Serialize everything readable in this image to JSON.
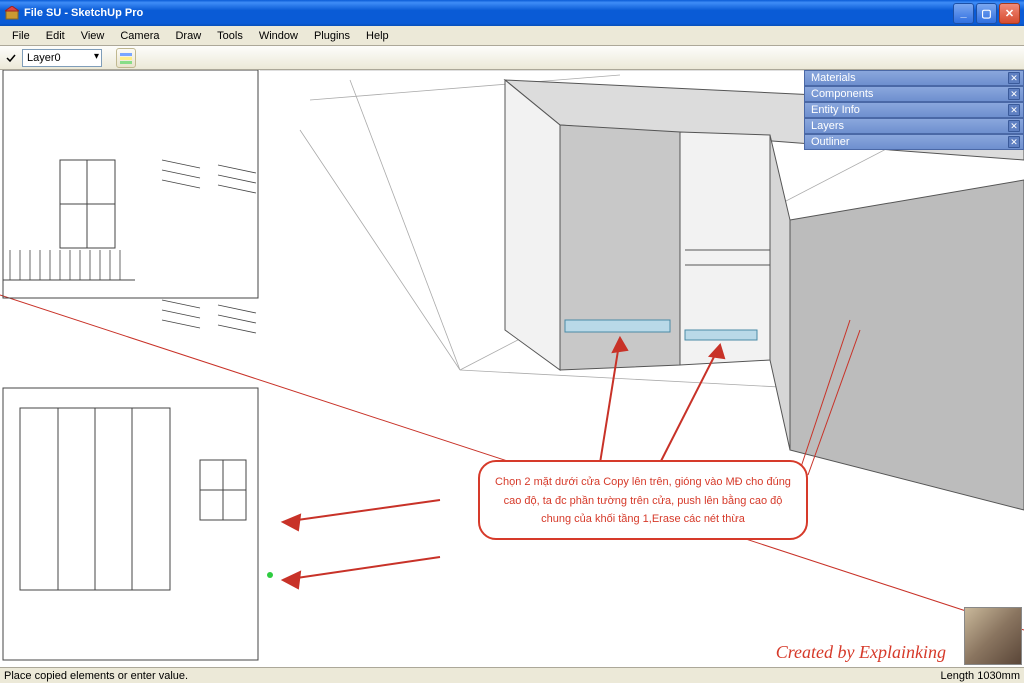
{
  "window": {
    "title": "File SU - SketchUp Pro"
  },
  "menu": {
    "items": [
      "File",
      "Edit",
      "View",
      "Camera",
      "Draw",
      "Tools",
      "Window",
      "Plugins",
      "Help"
    ]
  },
  "toolbar": {
    "layer_selected": "Layer0"
  },
  "panels": {
    "items": [
      "Materials",
      "Components",
      "Entity Info",
      "Layers",
      "Outliner"
    ]
  },
  "annotation": {
    "text": "Chọn 2 mặt dưới cửa Copy lên trên, gióng vào MĐ cho đúng cao độ, ta đc phần tường trên cửa, push lên bằng cao độ chung của khối tầng 1,Erase các nét thừa"
  },
  "watermark": {
    "text": "Created by Explainking"
  },
  "status": {
    "hint": "Place copied elements or enter value.",
    "measure_label": "Length",
    "measure_value": "1030mm"
  }
}
